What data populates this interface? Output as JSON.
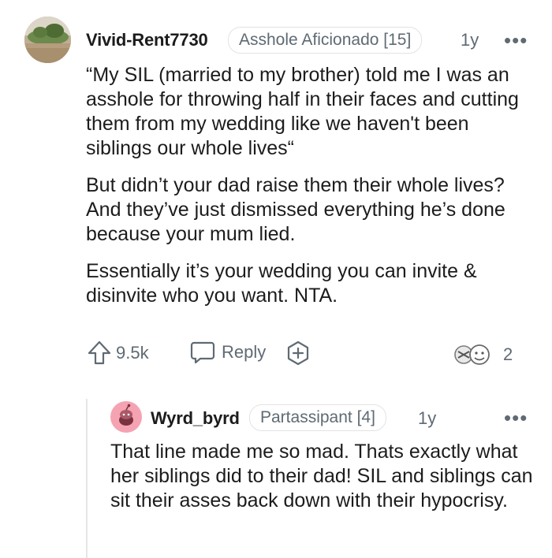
{
  "comment": {
    "username": "Vivid-Rent7730",
    "flair": "Asshole Aficionado [15]",
    "age": "1y",
    "more": "•••",
    "paragraphs": [
      "“My SIL (married to my brother) told me I was an asshole for throwing half in their faces and cutting them from my wedding like we haven't been siblings our whole lives“",
      "But didn’t your dad raise them their whole lives? And they’ve just dismissed everything he’s done because your mum lied.",
      "Essentially it’s your wedding you can invite & disinvite who you want. NTA."
    ],
    "actions": {
      "votes": "9.5k",
      "reply_label": "Reply",
      "awards_count": "2"
    }
  },
  "reply": {
    "username": "Wyrd_byrd",
    "flair": "Partassipant [4]",
    "age": "1y",
    "more": "•••",
    "body": "That line made me so mad. Thats exactly what her siblings did to their dad! SIL and siblings can sit their asses back down with their hypocrisy."
  },
  "colors": {
    "text": "#1c1c1c",
    "meta": "#5f6a73",
    "flair_border": "#e3e3e3",
    "avatar_pink": "#f5a3b2"
  },
  "icons": [
    "upvote-arrow-icon",
    "comment-bubble-icon",
    "award-plus-icon",
    "award-badges-icon",
    "more-dots-icon"
  ]
}
